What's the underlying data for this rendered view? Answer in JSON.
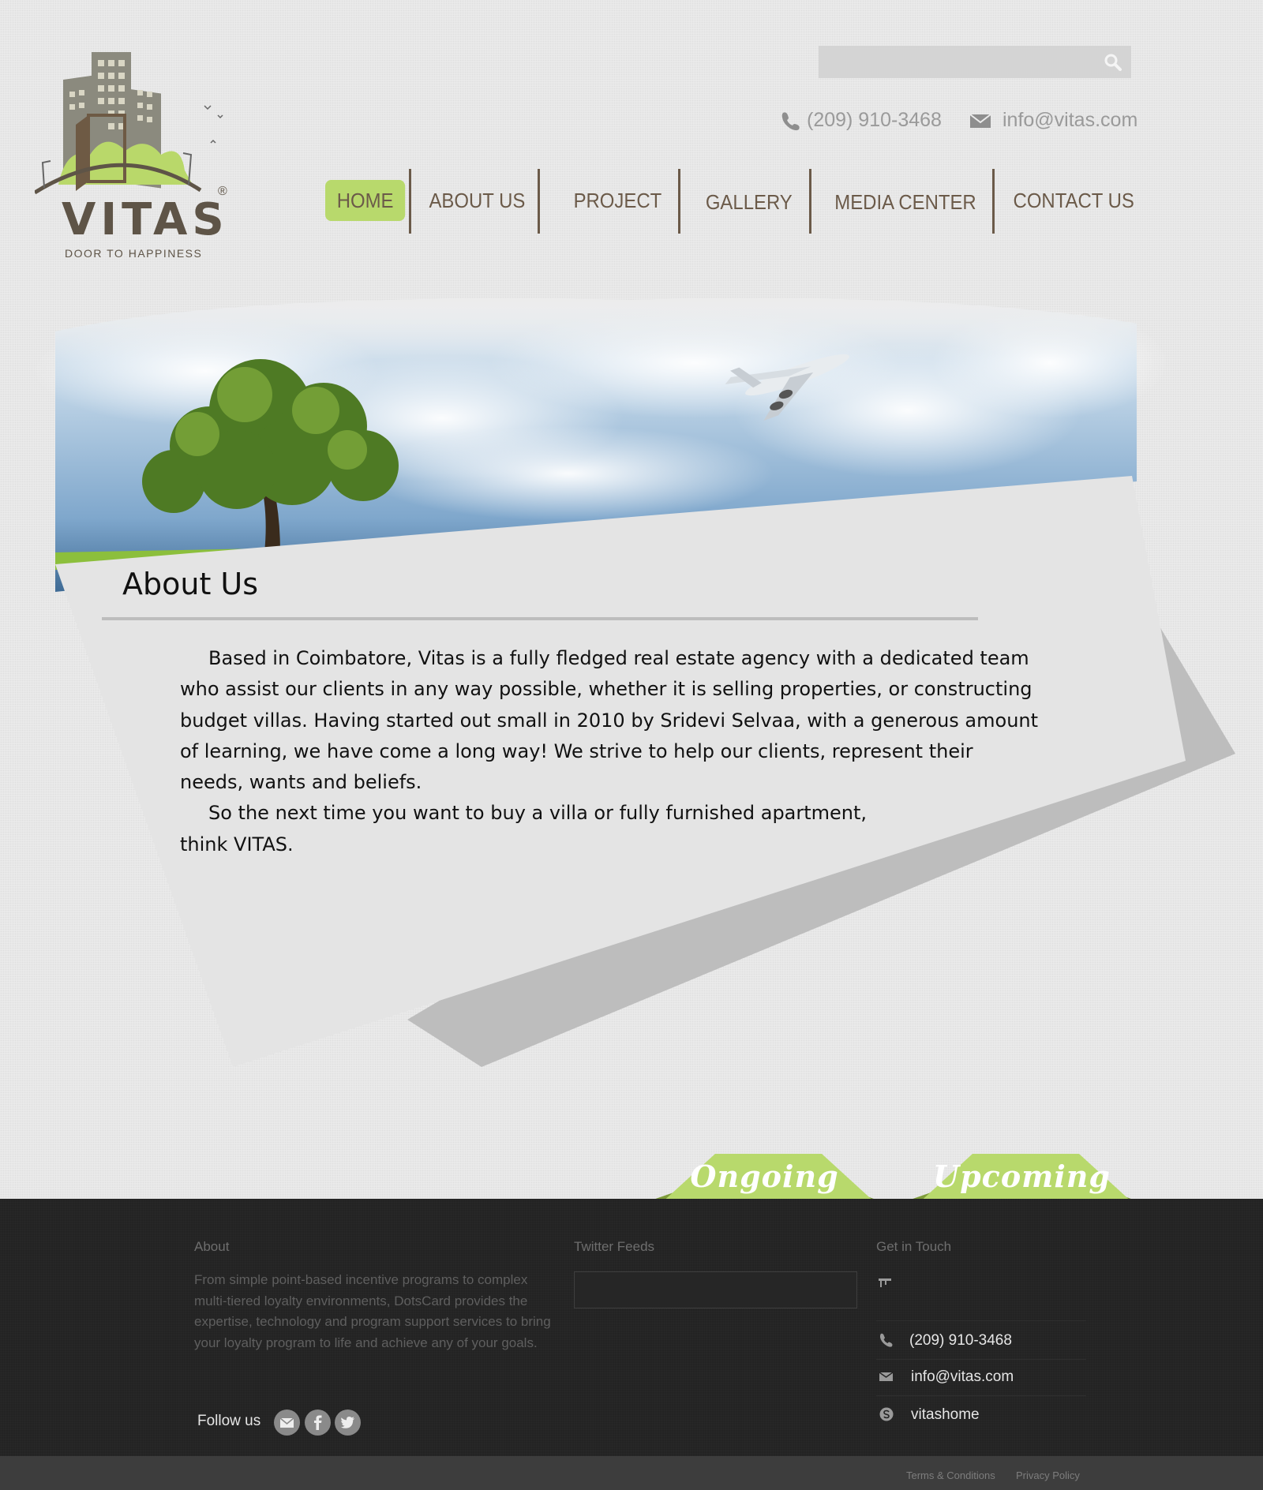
{
  "header": {
    "logo_word": "VITAS",
    "logo_tagline": "DOOR TO HAPPINESS",
    "logo_reg": "®",
    "search_placeholder": "",
    "phone": "(209) 910-3468",
    "email": "info@vitas.com"
  },
  "nav": {
    "items": [
      {
        "label": "HOME",
        "active": true
      },
      {
        "label": "ABOUT US",
        "active": false
      },
      {
        "label": "PROJECT",
        "active": false
      },
      {
        "label": "GALLERY",
        "active": false
      },
      {
        "label": "MEDIA CENTER",
        "active": false
      },
      {
        "label": "CONTACT US",
        "active": false
      }
    ]
  },
  "about": {
    "title": "About Us",
    "paragraph1": "Based in Coimbatore, Vitas is a fully fledged real estate agency with a dedicated team who assist our clients in any way possible, whether it is selling properties, or constructing budget villas. Having started out small in 2010 by Sridevi Selvaa, with a generous amount of learning, we have come a long way! We strive to help our clients, represent their needs, wants and be­liefs.",
    "paragraph2_line1": "So the next time you want to buy a villa or fully furnished apartment,",
    "paragraph2_line2": "think VITAS."
  },
  "tabs": {
    "ongoing": "Ongoing",
    "upcoming": "Upcoming"
  },
  "footer": {
    "about_heading": "About",
    "about_text": "From simple point-based incentive programs to complex multi-tiered loyalty environments, DotsCard provides the expertise, technology and program support services to bring your loyalty program to life and achieve any of your goals.",
    "follow_label": "Follow us",
    "twitter_heading": "Twitter Feeds",
    "contact_heading": "Get in Touch",
    "contact_phone": "(209) 910-3468",
    "contact_email": "info@vitas.com",
    "contact_skype": "vitashome",
    "terms": "Terms & Conditions",
    "privacy": "Privacy Policy"
  },
  "colors": {
    "accent_green": "#b8d96c",
    "nav_brown": "#6b5a49",
    "footer_bg": "#222222"
  },
  "icons": [
    "search-icon",
    "phone-icon",
    "mail-icon",
    "skype-icon",
    "facebook-icon",
    "twitter-icon",
    "sitemap-icon"
  ]
}
